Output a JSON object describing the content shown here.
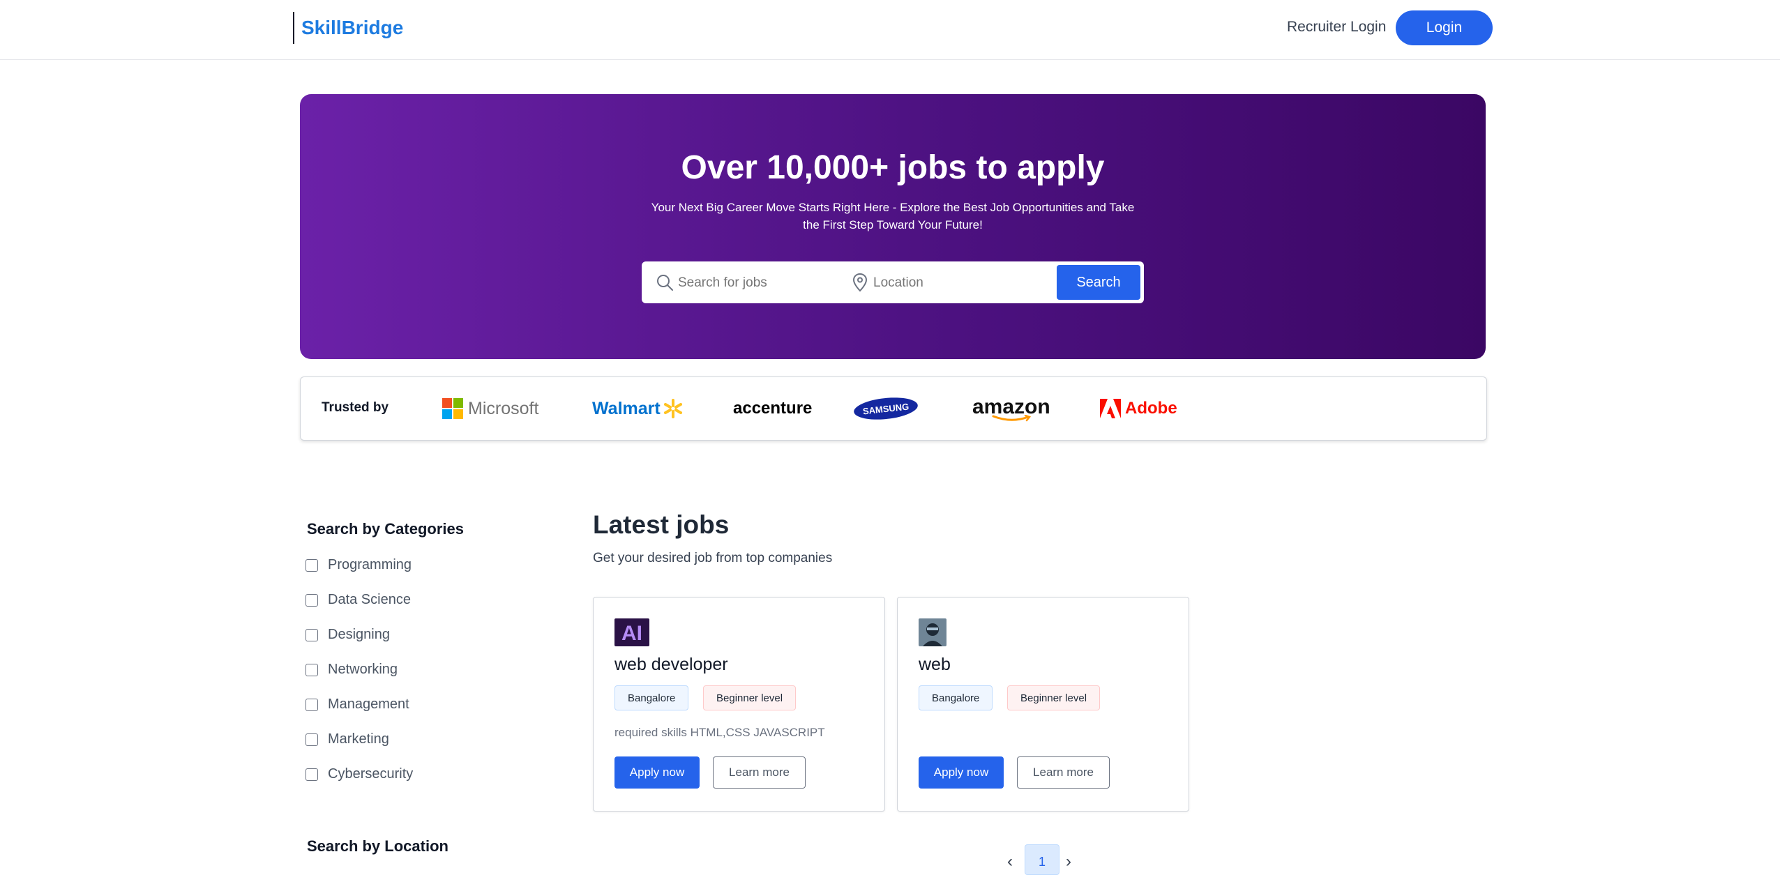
{
  "header": {
    "brand": "SkillBridge",
    "recruiter_login": "Recruiter Login",
    "login": "Login"
  },
  "hero": {
    "title": "Over 10,000+ jobs to apply",
    "subtitle": "Your Next Big Career Move Starts Right Here - Explore the Best Job Opportunities and Take the First Step Toward Your Future!",
    "search_placeholder": "Search for jobs",
    "location_placeholder": "Location",
    "search_button": "Search"
  },
  "trusted": {
    "label": "Trusted by",
    "companies": [
      "Microsoft",
      "Walmart",
      "accenture",
      "SAMSUNG",
      "amazon",
      "Adobe"
    ]
  },
  "sidebar": {
    "categories_title": "Search by Categories",
    "categories": [
      "Programming",
      "Data Science",
      "Designing",
      "Networking",
      "Management",
      "Marketing",
      "Cybersecurity"
    ],
    "location_title": "Search by Location"
  },
  "main": {
    "title": "Latest jobs",
    "subtitle": "Get your desired job from top companies",
    "jobs": [
      {
        "title": "web developer",
        "location": "Bangalore",
        "level": "Beginner level",
        "description": "required skills HTML,CSS JAVASCRIPT",
        "apply": "Apply now",
        "learn": "Learn more",
        "logo_icon": "ai-logo-icon"
      },
      {
        "title": "web",
        "location": "Bangalore",
        "level": "Beginner level",
        "description": "",
        "apply": "Apply now",
        "learn": "Learn more",
        "logo_icon": "avatar-logo-icon"
      }
    ],
    "pagination": {
      "prev": "‹",
      "current": "1",
      "next": "›"
    }
  },
  "colors": {
    "brand": "#1d7be0",
    "primary": "#2563eb",
    "hero_start": "#6b21a8",
    "hero_end": "#3b0764"
  }
}
